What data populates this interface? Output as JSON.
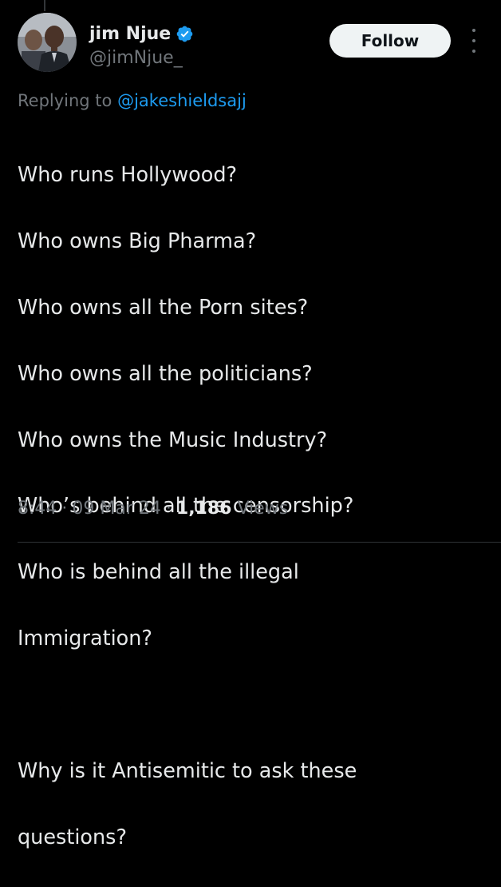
{
  "author": {
    "display_name": "jim Njue",
    "handle": "@jimNjue_",
    "verified_icon": "verified-badge-icon",
    "avatar_icon": "avatar"
  },
  "follow_label": "Follow",
  "more_icon": "more-options-icon",
  "replying": {
    "prefix": "Replying to",
    "mention": "@jakeshieldsajj"
  },
  "body": {
    "lines": [
      "Who runs Hollywood?",
      "Who owns Big Pharma?",
      "Who owns all the Porn sites?",
      "Who owns all the politicians?",
      "Who owns the Music Industry?",
      "Who’s behind all the censorship?",
      "Who is behind all the illegal",
      "Immigration?",
      "",
      "Why is it Antisemitic to ask these",
      "questions?"
    ]
  },
  "meta": {
    "time": "8:44",
    "date": "09 Mar 24",
    "views_count": "1,186",
    "views_label": "Views",
    "separator": "·"
  },
  "colors": {
    "background": "#000000",
    "text_primary": "#e7e9ea",
    "text_secondary": "#71767b",
    "accent": "#1d9bf0",
    "follow_bg": "#eff3f4"
  }
}
